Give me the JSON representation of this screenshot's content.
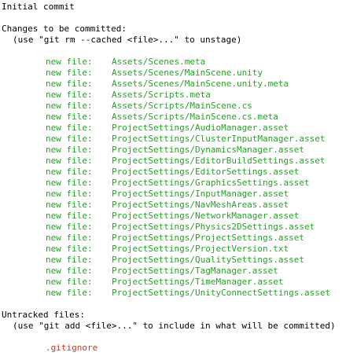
{
  "header": {
    "initial_commit": "Initial commit",
    "changes_heading": "Changes to be committed:",
    "changes_hint": "(use \"git rm --cached <file>...\" to unstage)"
  },
  "staged": {
    "label": "new file:",
    "files": [
      "Assets/Scenes.meta",
      "Assets/Scenes/MainScene.unity",
      "Assets/Scenes/MainScene.unity.meta",
      "Assets/Scripts.meta",
      "Assets/Scripts/MainScene.cs",
      "Assets/Scripts/MainScene.cs.meta",
      "ProjectSettings/AudioManager.asset",
      "ProjectSettings/ClusterInputManager.asset",
      "ProjectSettings/DynamicsManager.asset",
      "ProjectSettings/EditorBuildSettings.asset",
      "ProjectSettings/EditorSettings.asset",
      "ProjectSettings/GraphicsSettings.asset",
      "ProjectSettings/InputManager.asset",
      "ProjectSettings/NavMeshAreas.asset",
      "ProjectSettings/NetworkManager.asset",
      "ProjectSettings/Physics2DSettings.asset",
      "ProjectSettings/ProjectSettings.asset",
      "ProjectSettings/ProjectVersion.txt",
      "ProjectSettings/QualitySettings.asset",
      "ProjectSettings/TagManager.asset",
      "ProjectSettings/TimeManager.asset",
      "ProjectSettings/UnityConnectSettings.asset"
    ],
    "color": "#2aa02a"
  },
  "untracked": {
    "heading": "Untracked files:",
    "hint": "(use \"git add <file>...\" to include in what will be committed)",
    "files": [
      ".gitignore"
    ],
    "color": "#c0392b"
  }
}
